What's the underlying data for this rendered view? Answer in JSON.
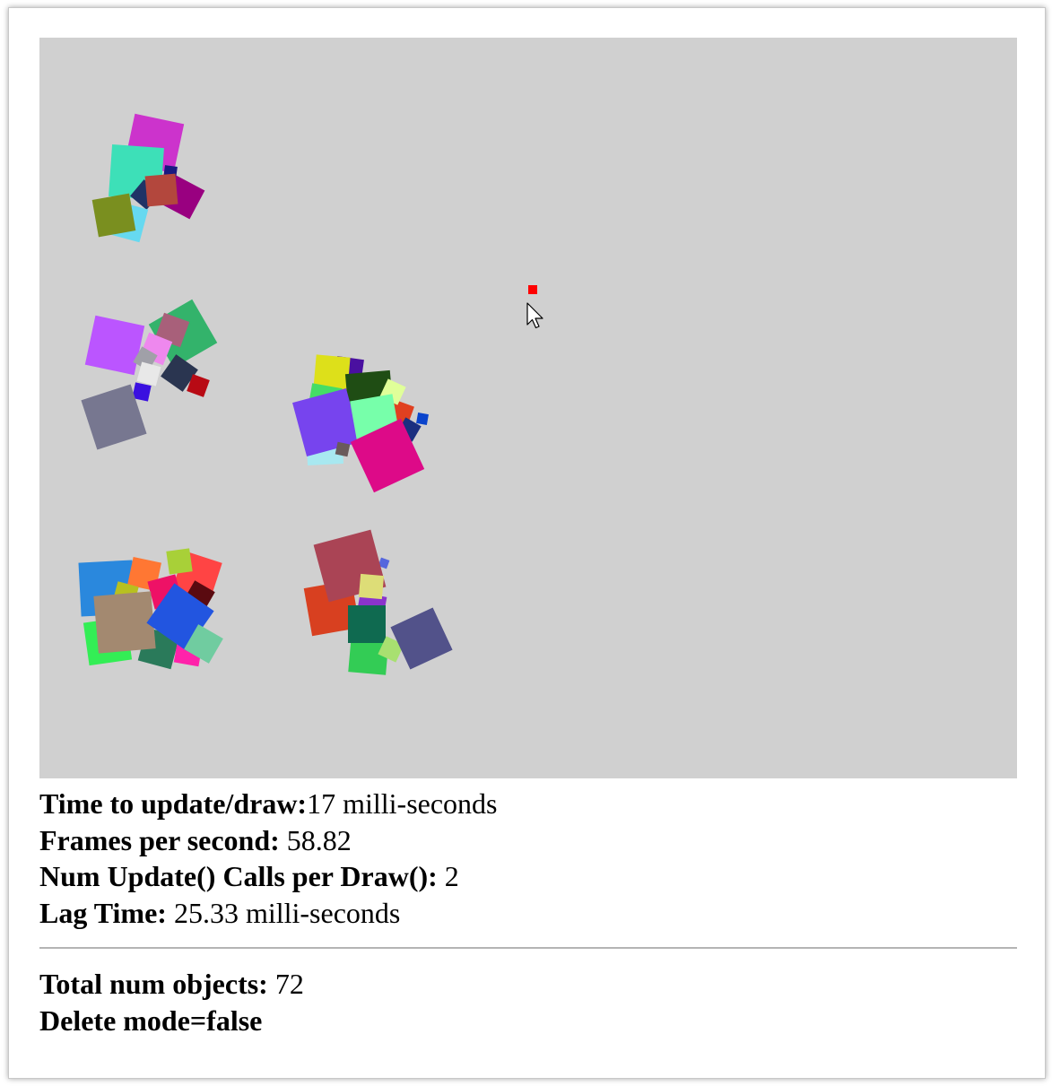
{
  "canvas": {
    "background": "#d0d0d0",
    "cursor_icon": "mouse-pointer-icon",
    "hero_color": "#ff0000",
    "object_groups": [
      {
        "name": "cluster-top-left",
        "objects": [
          {
            "color": "#cc33cc"
          },
          {
            "color": "#3de0b8"
          },
          {
            "color": "#1a1a80"
          },
          {
            "color": "#990080"
          },
          {
            "color": "#1f3366"
          },
          {
            "color": "#b3473d"
          },
          {
            "color": "#66d9f0"
          },
          {
            "color": "#7a8f1f"
          }
        ]
      },
      {
        "name": "cluster-middle-left",
        "objects": [
          {
            "color": "#33b36b"
          },
          {
            "color": "#bb55ff"
          },
          {
            "color": "#a8607a"
          },
          {
            "color": "#ee88ee"
          },
          {
            "color": "#a0a0a8"
          },
          {
            "color": "#e8e8e8"
          },
          {
            "color": "#2a3550"
          },
          {
            "color": "#b80a14"
          },
          {
            "color": "#3a10e0"
          },
          {
            "color": "#777790"
          }
        ]
      },
      {
        "name": "cluster-center",
        "objects": [
          {
            "color": "#4a10a0"
          },
          {
            "color": "#dde01a"
          },
          {
            "color": "#1f4d14"
          },
          {
            "color": "#44dd66"
          },
          {
            "color": "#e04020"
          },
          {
            "color": "#e0ff99"
          },
          {
            "color": "#a8e8f0"
          },
          {
            "color": "#7744ee"
          },
          {
            "color": "#77ffaa"
          },
          {
            "color": "#1a2f80"
          },
          {
            "color": "#0a44cc"
          },
          {
            "color": "#dd0a88"
          },
          {
            "color": "#6a5a5a"
          }
        ]
      },
      {
        "name": "cluster-bottom-left",
        "objects": [
          {
            "color": "#9933dd"
          },
          {
            "color": "#2a88dd"
          },
          {
            "color": "#ff7733"
          },
          {
            "color": "#ff4444"
          },
          {
            "color": "#a8d038"
          },
          {
            "color": "#ee1166"
          },
          {
            "color": "#b8c020"
          },
          {
            "color": "#5a0a10"
          },
          {
            "color": "#33ee55"
          },
          {
            "color": "#2a7a5a"
          },
          {
            "color": "#ff22aa"
          },
          {
            "color": "#a38970"
          },
          {
            "color": "#2255e0"
          },
          {
            "color": "#70cca0"
          }
        ]
      },
      {
        "name": "cluster-bottom-center",
        "objects": [
          {
            "color": "#5566dd"
          },
          {
            "color": "#d84020"
          },
          {
            "color": "#aa4455"
          },
          {
            "color": "#8a33cc"
          },
          {
            "color": "#dddd77"
          },
          {
            "color": "#33cc55"
          },
          {
            "color": "#0f6a50"
          },
          {
            "color": "#a8e070"
          },
          {
            "color": "#52528a"
          }
        ]
      }
    ]
  },
  "stats": {
    "update_draw_label": "Time to update/draw:",
    "update_draw_value": "17 milli-seconds",
    "fps_label": "Frames per second:",
    "fps_value": " 58.82",
    "num_update_label": "Num Update() Calls per Draw():",
    "num_update_value": " 2",
    "lag_label": "Lag Time:",
    "lag_value": " 25.33 milli-seconds",
    "total_objects_label": "Total num objects:",
    "total_objects_value": " 72",
    "delete_mode_label": "Delete mode=false"
  }
}
